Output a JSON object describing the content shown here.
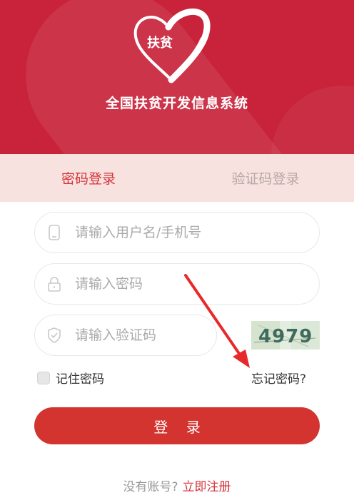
{
  "header": {
    "logo_text": "扶贫",
    "title": "全国扶贫开发信息系统"
  },
  "tabs": [
    {
      "label": "密码登录",
      "active": true
    },
    {
      "label": "验证码登录",
      "active": false
    }
  ],
  "form": {
    "username_placeholder": "请输入用户名/手机号",
    "username_icon": "phone-icon",
    "password_placeholder": "请输入密码",
    "password_icon": "lock-icon",
    "captcha_placeholder": "请输入验证码",
    "captcha_icon": "shield-icon",
    "captcha_code": "4979"
  },
  "options": {
    "remember_label": "记住密码",
    "remember_checked": false,
    "forgot_label": "忘记密码?"
  },
  "login_button_label": "登 录",
  "register": {
    "question": "没有账号?",
    "link": "立即注册"
  },
  "colors": {
    "brand_red": "#c8233a",
    "accent_red": "#d3342f",
    "tab_bg": "#f8e2df",
    "annotation_arrow": "#e8292b"
  }
}
